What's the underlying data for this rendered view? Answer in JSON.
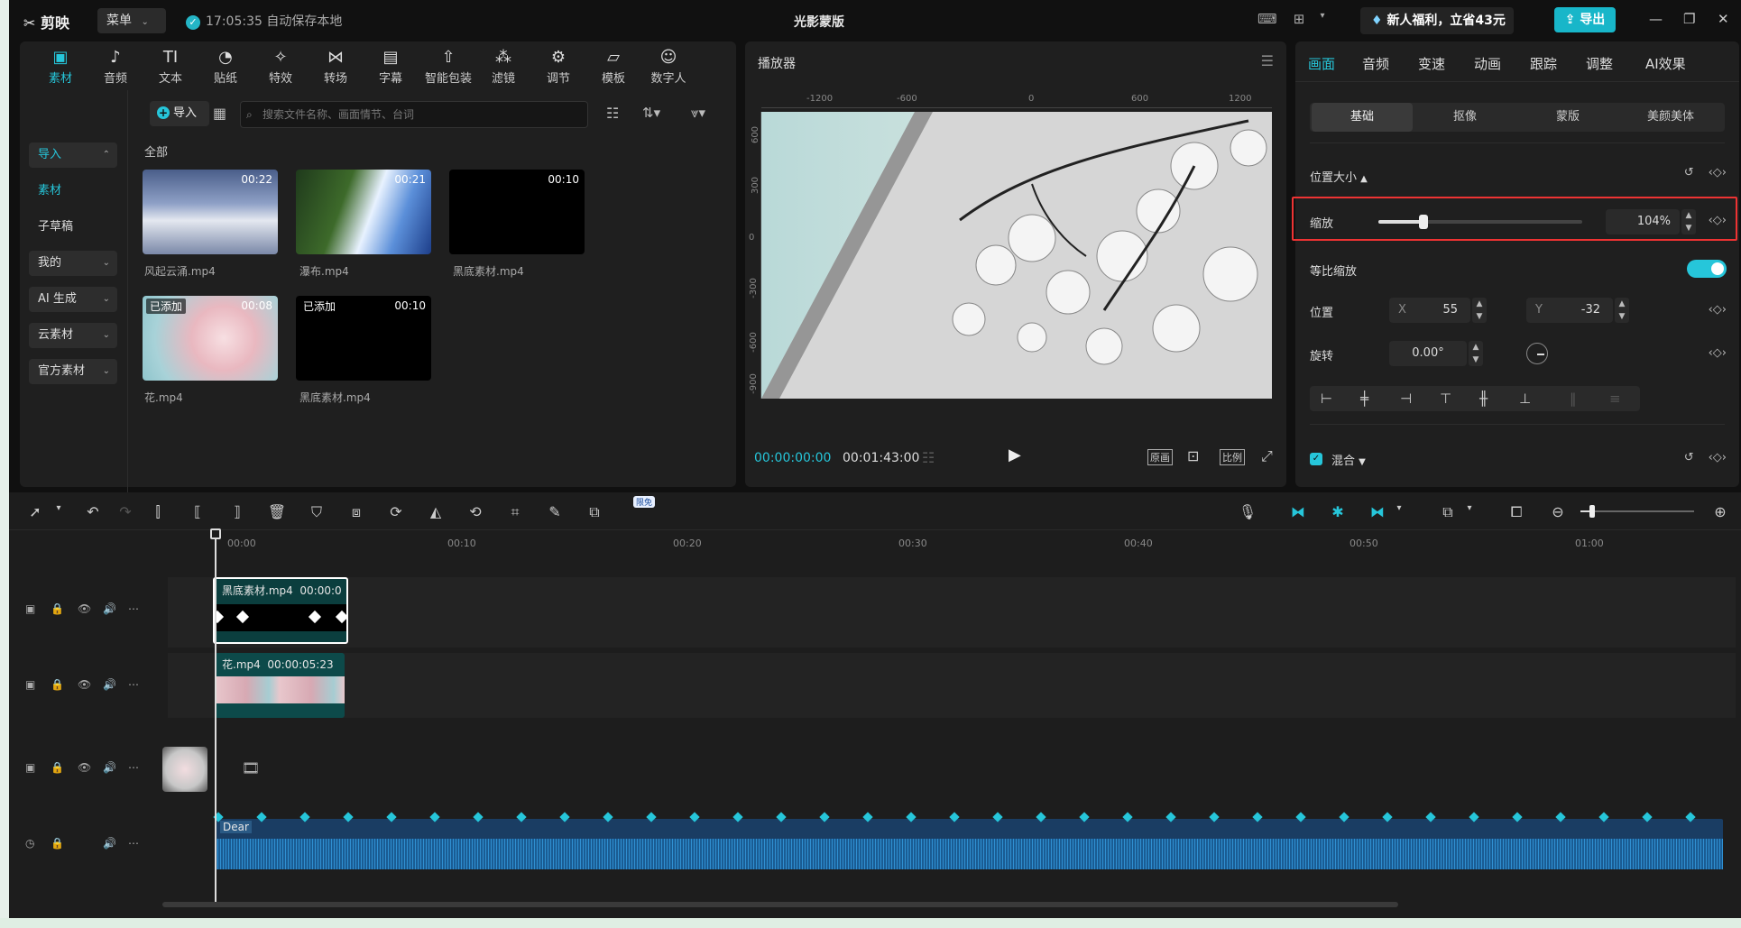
{
  "app": {
    "logo": "剪映",
    "menu": "菜单",
    "save_status": "17:05:35 自动保存本地",
    "title": "光影蒙版",
    "promo": "新人福利，立省43元",
    "export": "导出"
  },
  "media_tabs": [
    {
      "label": "素材",
      "icon": "▣"
    },
    {
      "label": "音频",
      "icon": "♪"
    },
    {
      "label": "文本",
      "icon": "TI"
    },
    {
      "label": "贴纸",
      "icon": "◔"
    },
    {
      "label": "特效",
      "icon": "✧"
    },
    {
      "label": "转场",
      "icon": "⋈"
    },
    {
      "label": "字幕",
      "icon": "▤"
    },
    {
      "label": "智能包装",
      "icon": "⇧"
    },
    {
      "label": "滤镜",
      "icon": "⁂"
    },
    {
      "label": "调节",
      "icon": "⚙"
    },
    {
      "label": "模板",
      "icon": "▱"
    },
    {
      "label": "数字人",
      "icon": "☺"
    }
  ],
  "sidebar": {
    "import": "导入",
    "items": [
      "素材",
      "子草稿"
    ],
    "groups": [
      "我的",
      "AI 生成",
      "云素材",
      "官方素材"
    ]
  },
  "library": {
    "import_btn": "导入",
    "search_placeholder": "搜索文件名称、画面情节、台词",
    "all_label": "全部",
    "items": [
      {
        "name": "风起云涌.mp4",
        "duration": "00:22",
        "added": ""
      },
      {
        "name": "瀑布.mp4",
        "duration": "00:21",
        "added": ""
      },
      {
        "name": "黑底素材.mp4",
        "duration": "00:10",
        "added": ""
      },
      {
        "name": "花.mp4",
        "duration": "00:08",
        "added": "已添加"
      },
      {
        "name": "黑底素材.mp4",
        "duration": "00:10",
        "added": "已添加"
      }
    ]
  },
  "player": {
    "title": "播放器",
    "ruler_h": [
      "-1200",
      "-600",
      "0",
      "600",
      "1200"
    ],
    "ruler_v": [
      "600",
      "300",
      "0",
      "-300",
      "-600",
      "-900"
    ],
    "current_time": "00:00:00:00",
    "total_time": "00:01:43:00",
    "btn_original": "原画",
    "btn_ratio": "比例"
  },
  "props": {
    "tabs": [
      "画面",
      "音频",
      "变速",
      "动画",
      "跟踪",
      "调整",
      "AI效果"
    ],
    "subtabs": [
      "基础",
      "抠像",
      "蒙版",
      "美颜美体"
    ],
    "section_pos": "位置大小",
    "scale_label": "缩放",
    "scale_value": "104%",
    "scale_level": 0.22,
    "uniform_label": "等比缩放",
    "position_label": "位置",
    "x_label": "X",
    "x_value": "55",
    "y_label": "Y",
    "y_value": "-32",
    "rotate_label": "旋转",
    "rotate_value": "0.00°",
    "blend_label": "混合"
  },
  "timeline": {
    "badge": "限免",
    "ruler": [
      "00:00",
      "00:10",
      "00:20",
      "00:30",
      "00:40",
      "00:50",
      "01:00"
    ],
    "clip1_name": "黑底素材.mp4",
    "clip1_dur": "00:00:0",
    "clip2_name": "花.mp4",
    "clip2_dur": "00:00:05:23",
    "audio_name": "Dear",
    "zoom_level": 0.1
  },
  "colors": {
    "accent": "#26c6da",
    "bg": "#101010",
    "panel": "#1f1f1f",
    "highlight": "#e33333"
  }
}
